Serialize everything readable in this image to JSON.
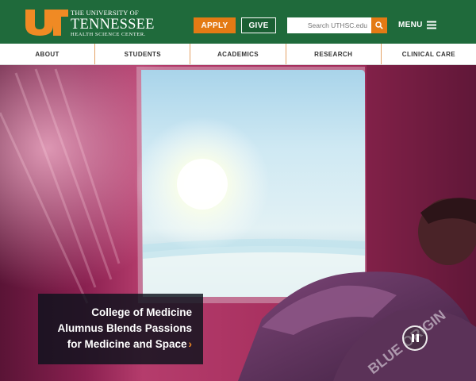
{
  "brand": {
    "line1": "THE UNIVERSITY OF",
    "line2": "TENNESSEE",
    "line3": "HEALTH SCIENCE CENTER.",
    "primary_color": "#1f6a3b",
    "accent_color": "#e37a14"
  },
  "header": {
    "apply_label": "APPLY",
    "give_label": "GIVE",
    "search_placeholder": "Search UTHSC.edu",
    "search_icon": "search-icon",
    "menu_label": "MENU",
    "menu_icon": "hamburger-icon"
  },
  "nav": {
    "items": [
      {
        "label": "ABOUT"
      },
      {
        "label": "STUDENTS"
      },
      {
        "label": "ACADEMICS"
      },
      {
        "label": "RESEARCH"
      },
      {
        "label": "CLINICAL CARE"
      }
    ]
  },
  "hero": {
    "caption_line1": "College of Medicine",
    "caption_line2": "Alumnus Blends Passions",
    "caption_line3": "for Medicine and Space",
    "caption_arrow": "›",
    "suit_text": "BLUE ORIGIN",
    "pause_icon": "pause-icon"
  }
}
